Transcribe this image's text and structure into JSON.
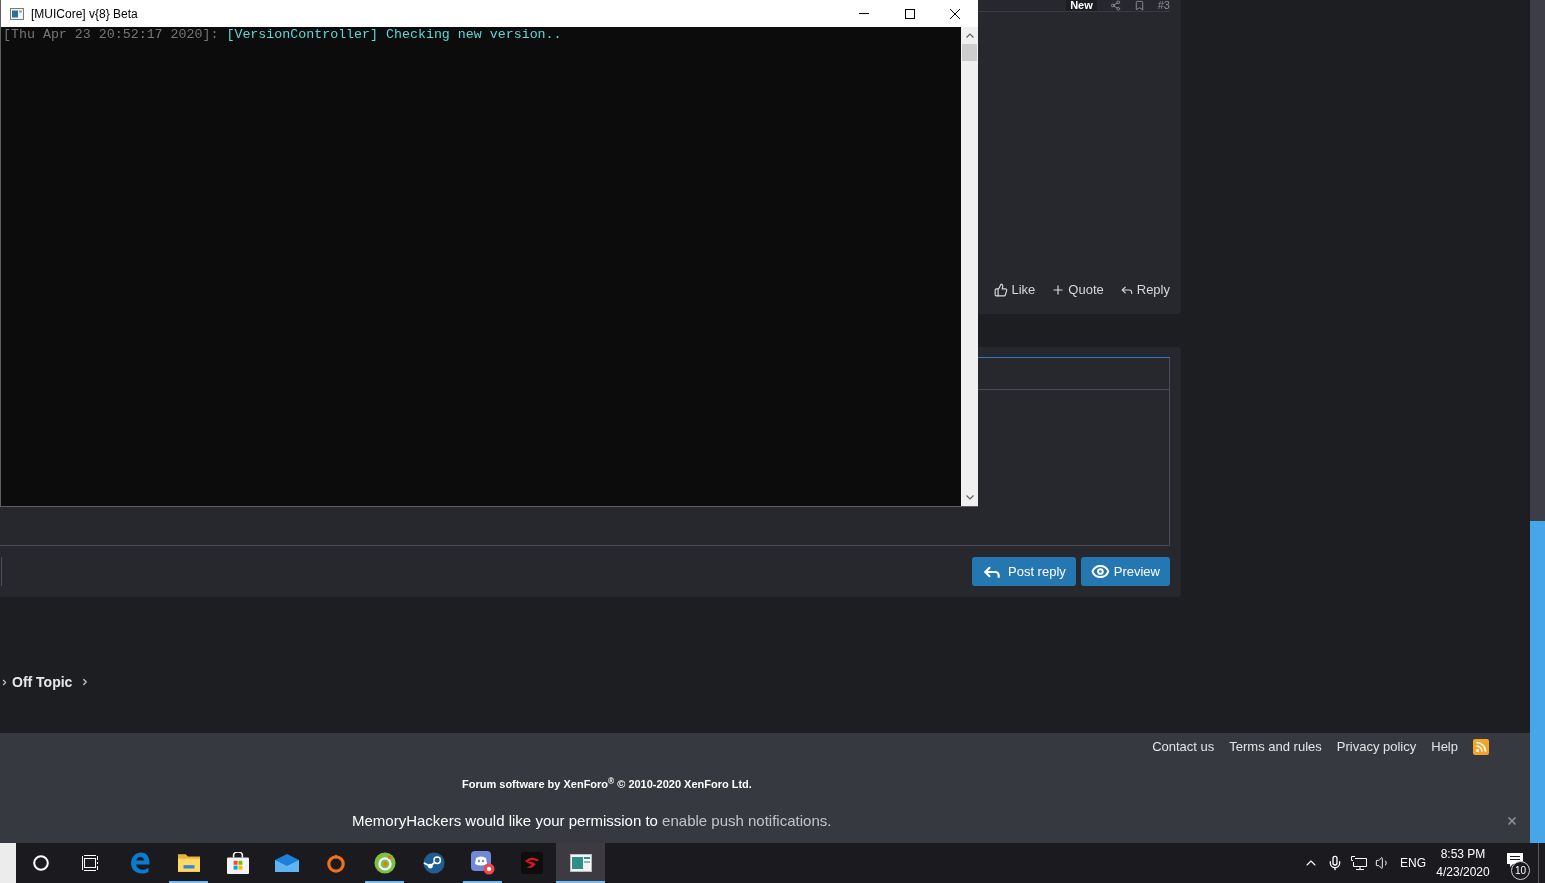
{
  "console_window": {
    "title": "[MUICore] v{8} Beta",
    "log": [
      {
        "timestamp": "[Thu Apr 23 20:52:17 2020]:",
        "message": "[VersionController] Checking new version.."
      }
    ]
  },
  "post": {
    "badge": "New",
    "number": "#3",
    "actions": [
      "Like",
      "Quote",
      "Reply"
    ]
  },
  "reply_form": {
    "buttons": [
      "Post reply",
      "Preview"
    ]
  },
  "breadcrumb": [
    "Off Topic"
  ],
  "footer": {
    "links": [
      "Contact us",
      "Terms and rules",
      "Privacy policy",
      "Help"
    ],
    "copyright": "Forum software by XenForo$^{®}$ © 2010-2020 XenForo Ltd."
  },
  "push_notice": {
    "text": "MemoryHackers would like your permission to",
    "link": "enable push notifications."
  },
  "taskbar": {
    "apps": [
      {
        "running": false,
        "selected": false
      },
      {
        "running": true,
        "selected": false
      },
      {
        "running": false,
        "selected": false
      },
      {
        "running": false,
        "selected": false
      },
      {
        "running": false,
        "selected": false
      },
      {
        "running": true,
        "selected": false
      },
      {
        "running": false,
        "selected": false
      },
      {
        "running": true,
        "selected": false
      },
      {
        "running": false,
        "selected": false
      },
      {
        "running": true,
        "selected": true
      }
    ],
    "tray": {
      "language": "ENG",
      "time": "8:53 PM",
      "date": "4/23/2020",
      "notification_count": "10"
    }
  }
}
